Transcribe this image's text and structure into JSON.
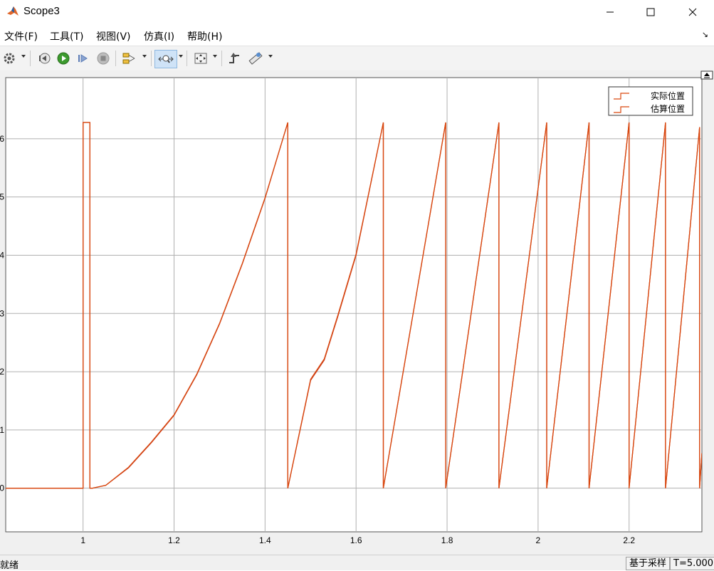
{
  "window": {
    "title": "Scope3"
  },
  "menu": {
    "items": [
      "文件(F)",
      "工具(T)",
      "视图(V)",
      "仿真(I)",
      "帮助(H)"
    ]
  },
  "status": {
    "ready": "就绪",
    "mode": "基于采样",
    "time": "T=5.000"
  },
  "colors": {
    "series": "#d9480f",
    "grid": "#b0b0b0"
  },
  "chart_data": {
    "type": "line",
    "xlim": [
      0.83,
      2.36
    ],
    "ylim": [
      -0.75,
      7.05
    ],
    "x_ticks": [
      "1",
      "1.2",
      "1.4",
      "1.6",
      "1.8",
      "2",
      "2.2"
    ],
    "x_tick_values": [
      1,
      1.2,
      1.4,
      1.6,
      1.8,
      2,
      2.2
    ],
    "y_ticks": [
      "0",
      "1",
      "2",
      "3",
      "4",
      "5",
      "6"
    ],
    "y_tick_values": [
      0,
      1,
      2,
      3,
      4,
      5,
      6
    ],
    "grid": true,
    "legend_position": "top-right",
    "series": [
      {
        "name": "实际位置",
        "x": [
          0.83,
          1.0,
          1.0,
          1.015,
          1.015,
          1.02,
          1.05,
          1.1,
          1.15,
          1.2,
          1.25,
          1.3,
          1.35,
          1.4,
          1.45,
          1.45,
          1.5,
          1.53,
          1.56,
          1.6,
          1.66,
          1.66,
          1.797,
          1.797,
          1.914,
          1.914,
          2.019,
          2.019,
          2.112,
          2.112,
          2.2,
          2.2,
          2.28,
          2.28,
          2.355,
          2.355,
          2.36
        ],
        "y": [
          0,
          0,
          6.28,
          6.28,
          0,
          0,
          0.05,
          0.35,
          0.78,
          1.25,
          1.95,
          2.82,
          3.85,
          4.98,
          6.28,
          0,
          1.85,
          2.2,
          2.95,
          4.0,
          6.28,
          0,
          6.28,
          0,
          6.28,
          0,
          6.28,
          0,
          6.28,
          0,
          6.28,
          0,
          6.28,
          0,
          6.2,
          0,
          0.6
        ]
      },
      {
        "name": "估算位置",
        "x": [
          0.83,
          1.0,
          1.0,
          1.015,
          1.015,
          1.02,
          1.05,
          1.1,
          1.15,
          1.2,
          1.25,
          1.3,
          1.35,
          1.4,
          1.45,
          1.45,
          1.5,
          1.53,
          1.56,
          1.6,
          1.66,
          1.66,
          1.797,
          1.797,
          1.914,
          1.914,
          2.019,
          2.019,
          2.112,
          2.112,
          2.2,
          2.2,
          2.28,
          2.28,
          2.355,
          2.355,
          2.36
        ],
        "y": [
          0,
          0,
          6.28,
          6.28,
          0,
          0,
          0.05,
          0.36,
          0.79,
          1.26,
          1.96,
          2.83,
          3.86,
          4.99,
          6.28,
          0,
          1.87,
          2.22,
          2.97,
          4.02,
          6.28,
          0,
          6.28,
          0,
          6.28,
          0,
          6.28,
          0,
          6.28,
          0,
          6.28,
          0,
          6.28,
          0,
          6.2,
          0,
          0.6
        ]
      }
    ]
  }
}
